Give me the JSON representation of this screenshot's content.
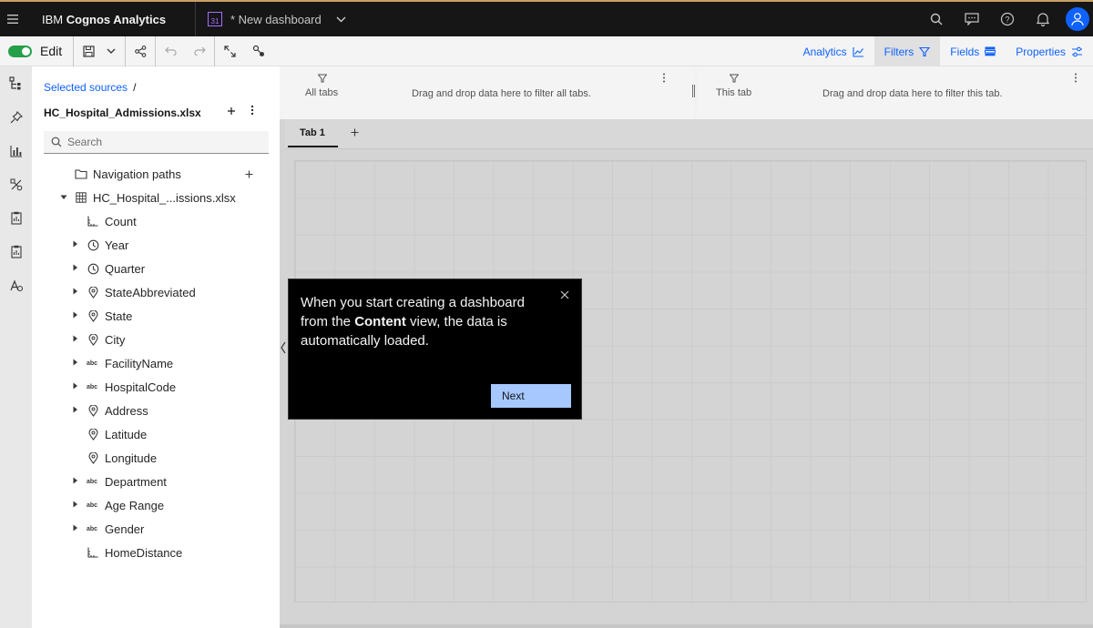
{
  "header": {
    "product_prefix": "IBM",
    "product_name": "Cognos Analytics",
    "dashboard_title": "* New dashboard",
    "dashboard_icon_text": "31"
  },
  "toolbar": {
    "edit_label": "Edit",
    "right_tabs": [
      {
        "label": "Analytics",
        "icon": "line-chart-icon"
      },
      {
        "label": "Filters",
        "icon": "filter-icon"
      },
      {
        "label": "Fields",
        "icon": "fields-icon"
      },
      {
        "label": "Properties",
        "icon": "sliders-icon"
      }
    ]
  },
  "panel": {
    "breadcrumb_link": "Selected sources",
    "breadcrumb_sep": "/",
    "source_name": "HC_Hospital_Admissions.xlsx",
    "search_placeholder": "Search",
    "tree": [
      {
        "label": "Navigation paths",
        "icon": "folder-icon",
        "caret": false,
        "level": 0
      },
      {
        "label": "HC_Hospital_...issions.xlsx",
        "icon": "table-icon",
        "caret": "down",
        "level": 0
      },
      {
        "label": "Count",
        "icon": "measure-icon",
        "caret": false,
        "level": 1
      },
      {
        "label": "Year",
        "icon": "time-icon",
        "caret": "right",
        "level": 1
      },
      {
        "label": "Quarter",
        "icon": "time-icon",
        "caret": "right",
        "level": 1
      },
      {
        "label": "StateAbbreviated",
        "icon": "location-icon",
        "caret": "right",
        "level": 1
      },
      {
        "label": "State",
        "icon": "location-icon",
        "caret": "right",
        "level": 1
      },
      {
        "label": "City",
        "icon": "location-icon",
        "caret": "right",
        "level": 1
      },
      {
        "label": "FacilityName",
        "icon": "text-icon",
        "caret": "right",
        "level": 1
      },
      {
        "label": "HospitalCode",
        "icon": "text-icon",
        "caret": "right",
        "level": 1
      },
      {
        "label": "Address",
        "icon": "location-icon",
        "caret": "right",
        "level": 1
      },
      {
        "label": "Latitude",
        "icon": "location-icon",
        "caret": false,
        "level": 1
      },
      {
        "label": "Longitude",
        "icon": "location-icon",
        "caret": false,
        "level": 1
      },
      {
        "label": "Department",
        "icon": "text-icon",
        "caret": "right",
        "level": 1
      },
      {
        "label": "Age Range",
        "icon": "text-icon",
        "caret": "right",
        "level": 1
      },
      {
        "label": "Gender",
        "icon": "text-icon",
        "caret": "right",
        "level": 1
      },
      {
        "label": "HomeDistance",
        "icon": "measure-icon",
        "caret": false,
        "level": 1
      }
    ]
  },
  "filters": {
    "all_tabs_label": "All tabs",
    "all_tabs_hint": "Drag and drop data here to filter all tabs.",
    "this_tab_label": "This tab",
    "this_tab_hint": "Drag and drop data here to filter this tab."
  },
  "tabs": {
    "tab1_label": "Tab 1"
  },
  "tour": {
    "text_before": "When you start creating a dashboard from the ",
    "text_bold": "Content",
    "text_after": " view, the data is automatically loaded.",
    "next_label": "Next"
  },
  "colors": {
    "accent": "#0f62fe",
    "toggle_on": "#24a148",
    "tour_button": "#a6c8ff"
  }
}
